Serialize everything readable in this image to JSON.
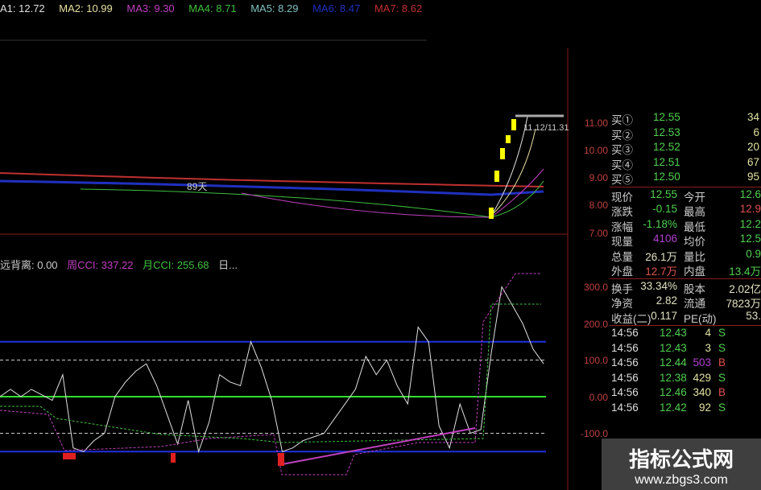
{
  "ma_bar": [
    {
      "label": "A1: 12.72",
      "color": "#e0e0e0"
    },
    {
      "label": "MA2: 10.99",
      "color": "#e8e0a0"
    },
    {
      "label": "MA3: 9.30",
      "color": "#c040c0"
    },
    {
      "label": "MA4: 8.71",
      "color": "#40c040"
    },
    {
      "label": "MA5: 8.29",
      "color": "#80c0c0"
    },
    {
      "label": "MA6: 8.47",
      "color": "#2030c0"
    },
    {
      "label": "MA7: 8.62",
      "color": "#c03030"
    }
  ],
  "indicator_bar": [
    {
      "label": "远背离: 0.00",
      "color": "#ccc"
    },
    {
      "label": "周CCI: 337.22",
      "color": "#c040c0"
    },
    {
      "label": "月CCI: 255.68",
      "color": "#40c040"
    },
    {
      "label": "日...",
      "color": "#ccc"
    }
  ],
  "price_annotation": "89天",
  "high_label": "11.12/11.31",
  "price_axis": [
    "11.00",
    "10.00",
    "9.00",
    "8.00",
    "7.00"
  ],
  "cci_axis": [
    "300.0",
    "200.0",
    "100.0",
    "0.00",
    "-100.0"
  ],
  "quote": {
    "bids": [
      {
        "label": "买①",
        "price": "12.55",
        "vol": "34"
      },
      {
        "label": "买②",
        "price": "12.53",
        "vol": "6"
      },
      {
        "label": "买③",
        "price": "12.52",
        "vol": "20"
      },
      {
        "label": "买④",
        "price": "12.51",
        "vol": "67"
      },
      {
        "label": "买⑤",
        "price": "12.50",
        "vol": "95"
      }
    ],
    "stats": [
      {
        "l1": "现价",
        "v1": "12.55",
        "c1": "#50d050",
        "l2": "今开",
        "v2": "12.6",
        "c2": "#50d050"
      },
      {
        "l1": "涨跌",
        "v1": "-0.15",
        "c1": "#50d050",
        "l2": "最高",
        "v2": "12.9",
        "c2": "#e05050"
      },
      {
        "l1": "涨幅",
        "v1": "-1.18%",
        "c1": "#50d050",
        "l2": "最低",
        "v2": "12.2",
        "c2": "#50d050"
      },
      {
        "l1": "现量",
        "v1": "4106",
        "c1": "#b040d0",
        "l2": "均价",
        "v2": "12.5",
        "c2": "#50d050"
      },
      {
        "l1": "总量",
        "v1": "26.1万",
        "c1": "#e0e0c0",
        "l2": "量比",
        "v2": "0.9",
        "c2": "#50d050"
      },
      {
        "l1": "外盘",
        "v1": "12.7万",
        "c1": "#e05050",
        "l2": "内盘",
        "v2": "13.4万",
        "c2": "#50d050"
      },
      {
        "l1": "换手",
        "v1": "33.34%",
        "c1": "#e0e0c0",
        "l2": "股本",
        "v2": "2.02亿",
        "c2": "#e0e0c0"
      },
      {
        "l1": "净资",
        "v1": "2.82",
        "c1": "#e0e0c0",
        "l2": "流通",
        "v2": "7823万",
        "c2": "#e0e0c0"
      },
      {
        "l1": "收益(二)",
        "v1": "0.117",
        "c1": "#e0e0c0",
        "l2": "PE(动)",
        "v2": "53.",
        "c2": "#e0e0c0"
      }
    ],
    "ticks": [
      {
        "t": "14:56",
        "p": "12.43",
        "v": "4",
        "s": "S",
        "vc": "#e0e0a0"
      },
      {
        "t": "14:56",
        "p": "12.43",
        "v": "3",
        "s": "S",
        "vc": "#e0e0a0"
      },
      {
        "t": "14:56",
        "p": "12.44",
        "v": "503",
        "s": "B",
        "vc": "#b040d0"
      },
      {
        "t": "14:56",
        "p": "12.38",
        "v": "429",
        "s": "S",
        "vc": "#e0e0a0"
      },
      {
        "t": "14:56",
        "p": "12.46",
        "v": "340",
        "s": "B",
        "vc": "#e0e0a0"
      },
      {
        "t": "14:56",
        "p": "12.42",
        "v": "92",
        "s": "S",
        "vc": "#e0e0a0"
      }
    ]
  },
  "watermark": {
    "title": "指标公式网",
    "url": "www.zbgs3.com"
  },
  "chart_data": {
    "type": "line",
    "title": "CCI",
    "ylim": [
      -200,
      350
    ],
    "series": [
      {
        "name": "CCI",
        "values": [
          0,
          20,
          0,
          20,
          5,
          -10,
          60,
          -140,
          -150,
          -120,
          -100,
          0,
          40,
          70,
          90,
          30,
          -50,
          -130,
          -10,
          -150,
          -70,
          60,
          40,
          30,
          150,
          80,
          -10,
          -150,
          -140,
          -120,
          -110,
          -100,
          -60,
          -20,
          20,
          110,
          60,
          100,
          30,
          -20,
          190,
          150,
          -80,
          -140,
          -20,
          -100,
          -90,
          120,
          300,
          250,
          200,
          130,
          90
        ]
      }
    ],
    "levels": [
      150,
      100,
      0,
      -100,
      -150
    ]
  }
}
